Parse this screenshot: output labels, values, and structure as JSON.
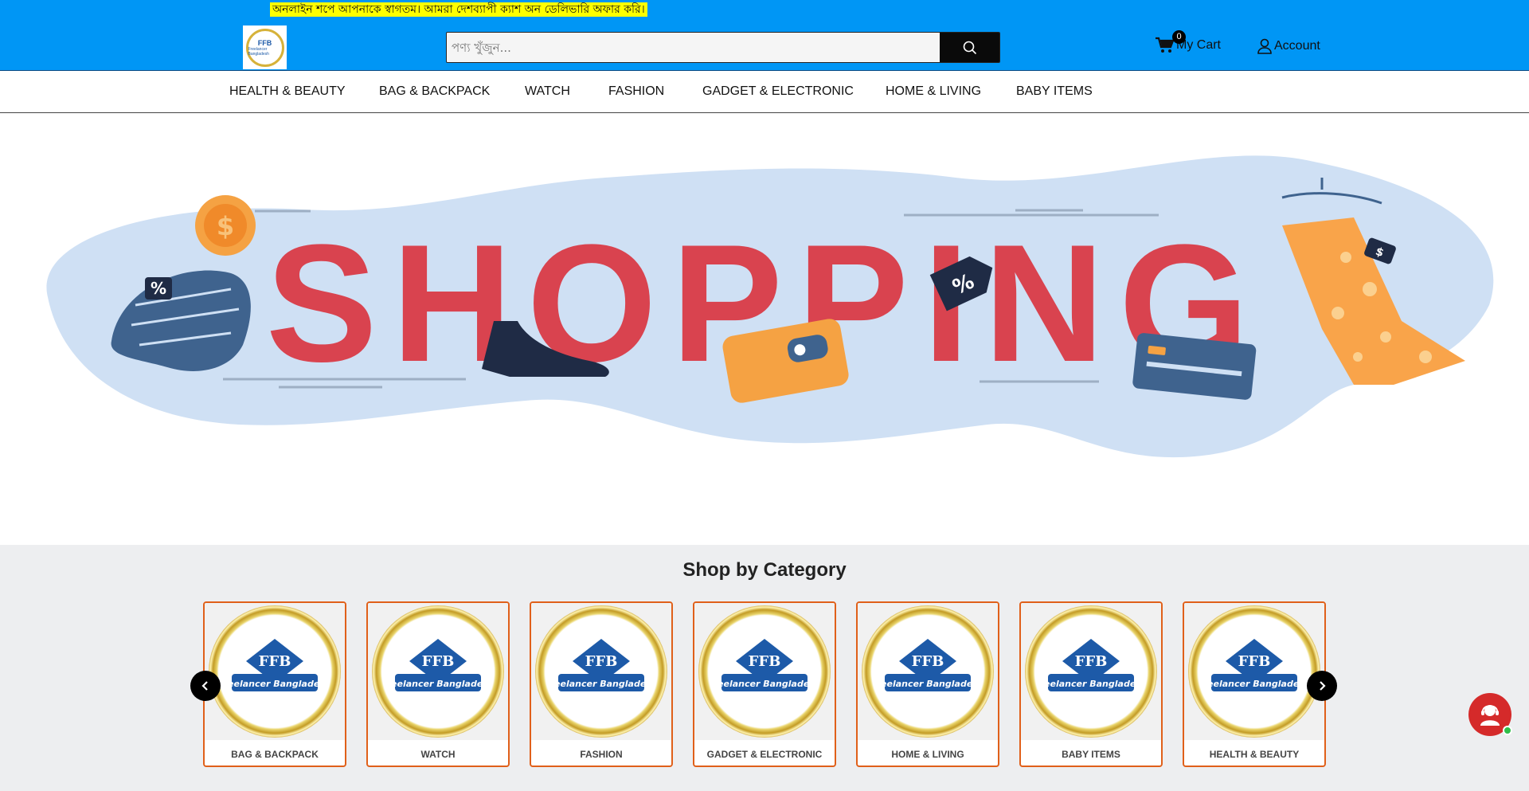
{
  "header": {
    "announcement": "অনলাইন শপে আপনাকে স্বাগতম। আমরা দেশব্যাপী ক্যাশ অন ডেলিভারি অফার করি।",
    "search_placeholder": "পণ্য খুঁজুন...",
    "cart_count": "0",
    "cart_label": "My Cart",
    "account_label": "Account"
  },
  "nav": {
    "items": [
      "HEALTH & BEAUTY",
      "BAG & BACKPACK",
      "WATCH",
      "FASHION",
      "GADGET & ELECTRONIC",
      "HOME & LIVING",
      "BABY ITEMS"
    ]
  },
  "banner": {
    "headline": "SHOPPING"
  },
  "categories": {
    "title": "Shop by Category",
    "items": [
      {
        "label": "BAG & BACKPACK"
      },
      {
        "label": "WATCH"
      },
      {
        "label": "FASHION"
      },
      {
        "label": "GADGET & ELECTRONIC"
      },
      {
        "label": "HOME & LIVING"
      },
      {
        "label": "BABY ITEMS"
      },
      {
        "label": "HEALTH & BEAUTY"
      }
    ]
  },
  "colors": {
    "header_bg": "#0096f5",
    "announcement_bg": "#ffff00",
    "card_border": "#e0601a",
    "banner_text": "#d9434f",
    "contact_bg": "#d52a2a"
  },
  "icons": {
    "search": "search-icon",
    "cart": "cart-icon",
    "account": "user-icon",
    "prev": "chevron-left-icon",
    "next": "chevron-right-icon",
    "contact": "contact-agent-icon"
  }
}
